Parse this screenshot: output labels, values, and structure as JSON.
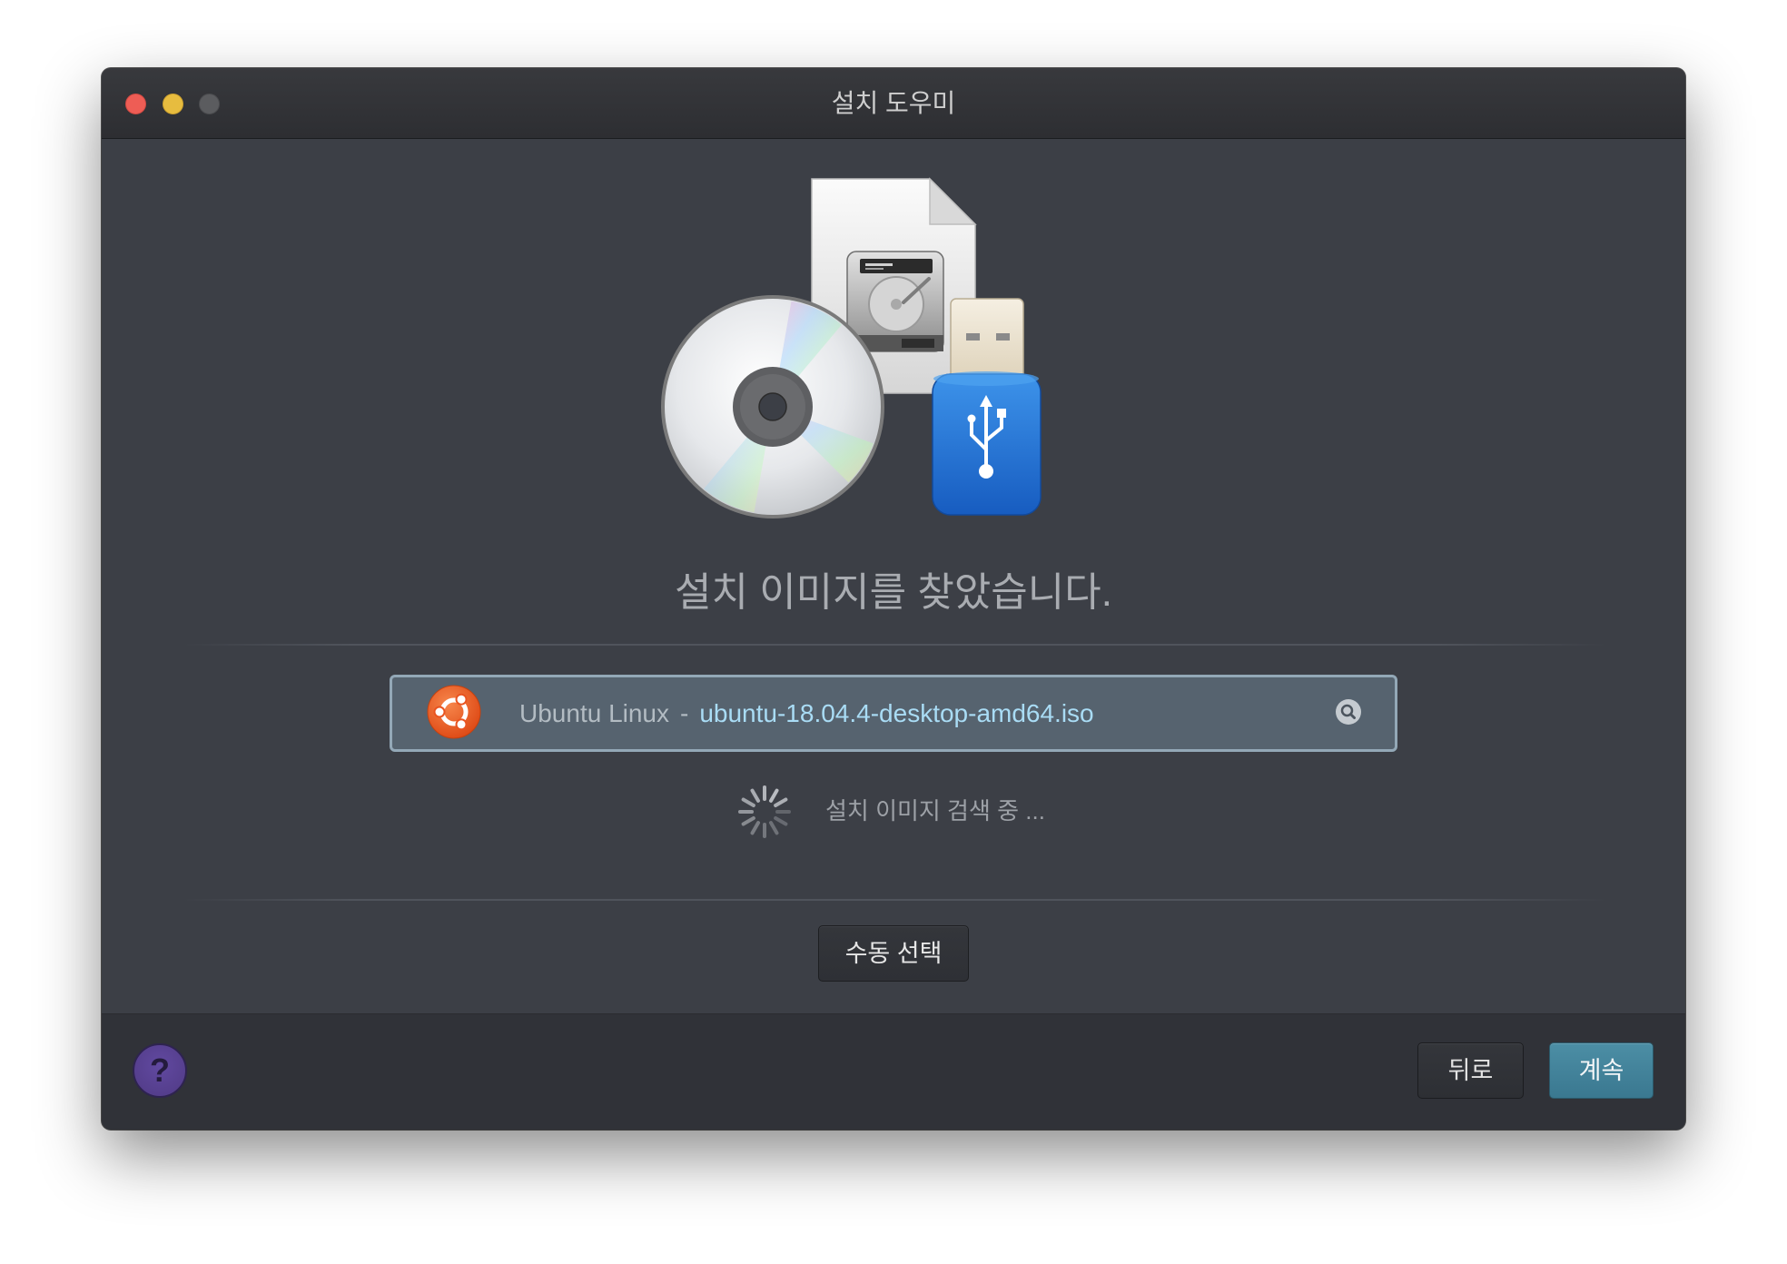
{
  "window": {
    "title": "설치 도우미"
  },
  "heading": "설치 이미지를 찾았습니다.",
  "found_image": {
    "os_name": "Ubuntu Linux",
    "separator": "-",
    "file_name": "ubuntu-18.04.4-desktop-amd64.iso",
    "icon": "ubuntu-logo-icon",
    "action_icon": "search-icon"
  },
  "status": {
    "text": "설치 이미지 검색 중 ...",
    "icon": "spinner-icon"
  },
  "manual_button": "수동 선택",
  "footer": {
    "help_label": "?",
    "back_label": "뒤로",
    "continue_label": "계속"
  },
  "illustration_icons": [
    "document-icon",
    "hard-drive-icon",
    "disc-icon",
    "usb-drive-icon"
  ],
  "colors": {
    "window_background": "#3c3f46",
    "titlebar_background": "#2d2e32",
    "footer_background": "#303238",
    "traffic_close": "#ee5d55",
    "traffic_minimize": "#e7bc3f",
    "traffic_zoom_disabled": "#5b5c5f",
    "found_box_background": "#56636f",
    "found_box_border": "#93a8b7",
    "file_name_text": "#a9dcf5",
    "continue_button": "#3e7f95",
    "help_button": "#5a4490",
    "ubuntu_orange": "#e95420"
  }
}
